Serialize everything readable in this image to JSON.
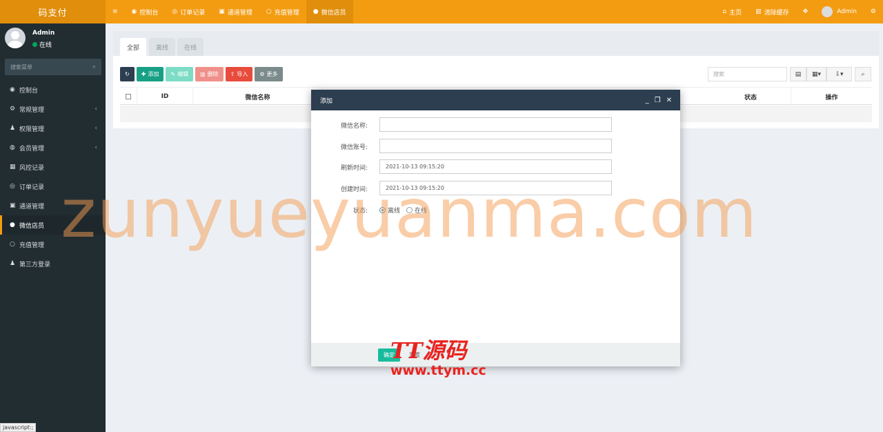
{
  "brand": "码支付",
  "topnav": {
    "menu_icon": "menu-icon",
    "items": [
      {
        "label": "控制台",
        "icon": "dashboard-icon"
      },
      {
        "label": "订单记录",
        "icon": "order-icon"
      },
      {
        "label": "通道管理",
        "icon": "channel-icon"
      },
      {
        "label": "充值管理",
        "icon": "recharge-icon"
      },
      {
        "label": "微信店员",
        "icon": "wechat-icon"
      }
    ],
    "right": {
      "home": "主页",
      "clear_cache": "清除缓存",
      "user": "Admin"
    }
  },
  "sidebar": {
    "user_name": "Admin",
    "user_status": "在线",
    "search_placeholder": "搜索菜单",
    "items": [
      {
        "label": "控制台",
        "icon": "dashboard-icon"
      },
      {
        "label": "常规管理",
        "icon": "cogs-icon"
      },
      {
        "label": "权限管理",
        "icon": "users-icon"
      },
      {
        "label": "会员管理",
        "icon": "user-circle-icon"
      },
      {
        "label": "风控记录",
        "icon": "map-icon"
      },
      {
        "label": "订单记录",
        "icon": "order-icon"
      },
      {
        "label": "通道管理",
        "icon": "channel-icon"
      },
      {
        "label": "微信店员",
        "icon": "wechat-icon"
      },
      {
        "label": "充值管理",
        "icon": "recharge-icon"
      },
      {
        "label": "第三方登录",
        "icon": "users-icon"
      }
    ]
  },
  "tabs": [
    "全部",
    "离线",
    "在线"
  ],
  "toolbar": {
    "add": "添加",
    "edit": "编辑",
    "delete": "删除",
    "import": "导入",
    "more": "更多"
  },
  "search_placeholder": "搜索",
  "table": {
    "columns": [
      "ID",
      "微信名称",
      "状态",
      "操作"
    ]
  },
  "modal": {
    "title": "添加",
    "fields": [
      {
        "label": "微信名称:",
        "value": ""
      },
      {
        "label": "微信账号:",
        "value": ""
      },
      {
        "label": "刷新时间:",
        "value": "2021-10-13 09:15:20"
      },
      {
        "label": "创建时间:",
        "value": "2021-10-13 09:15:20"
      }
    ],
    "status_label": "状态:",
    "status_options": [
      "离线",
      "在线"
    ],
    "confirm": "确定",
    "reset": "重置"
  },
  "statusbar": "javascript:;",
  "watermark": "zunyueyuanma.com",
  "watermark2": {
    "title": "TT源码",
    "url": "www.ttym.cc"
  }
}
